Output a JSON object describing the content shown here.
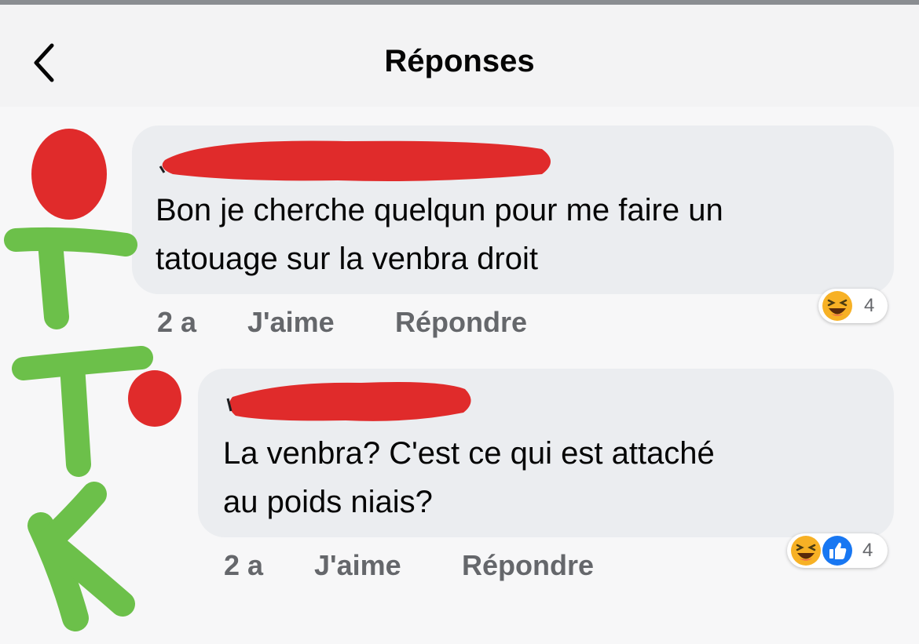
{
  "header": {
    "title": "Réponses",
    "back_icon": "chevron-left-icon"
  },
  "comments": [
    {
      "text_line1": "Bon je cherche quelqun  pour me faire un",
      "text_line2": "tatouage sur la venbra droit",
      "time": "2 a",
      "like_label": "J'aime",
      "reply_label": "Répondre",
      "reaction_icons": [
        "haha-icon"
      ],
      "reaction_count": "4"
    },
    {
      "text_line1": "La venbra? C'est ce qui est attaché",
      "text_line2": "au poids niais?",
      "time": "2 a",
      "like_label": "J'aime",
      "reply_label": "Répondre",
      "reaction_icons": [
        "haha-icon",
        "like-icon"
      ],
      "reaction_count": "4"
    }
  ],
  "annotations": {
    "redaction_color": "#e02b2b",
    "marker_color": "#6cc04a",
    "handwritten_letters": "TTK"
  },
  "colors": {
    "bubble": "#ebedf0",
    "meta_text": "#65676b",
    "haha_yellow": "#f7b125",
    "like_blue": "#1877f2"
  }
}
